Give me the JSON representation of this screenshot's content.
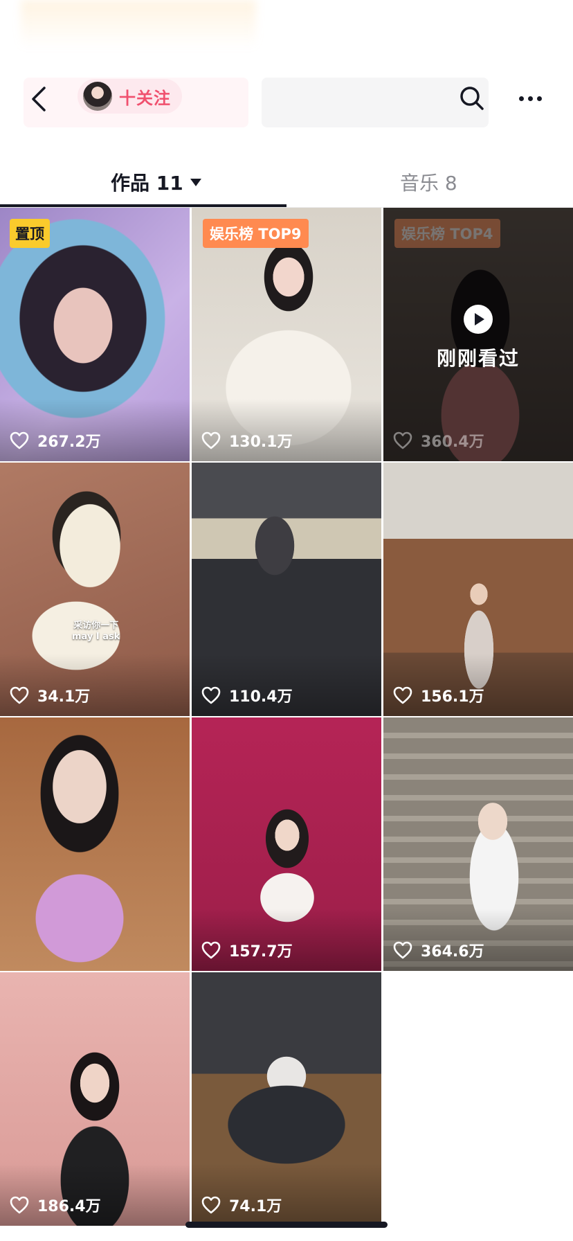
{
  "header": {
    "follow_label": "十关注",
    "back_icon": "chevron-left-icon",
    "search_icon": "search-icon",
    "more_icon": "more-dots-icon"
  },
  "tabs": {
    "works_label": "作品 11",
    "music_label": "音乐 8"
  },
  "videos": [
    {
      "likes": "267.2万",
      "badge": "置顶"
    },
    {
      "likes": "130.1万",
      "badge": "娱乐榜 TOP9"
    },
    {
      "likes": "360.4万",
      "badge": "娱乐榜 TOP4",
      "recent_label": "刚刚看过"
    },
    {
      "likes": "34.1万",
      "sticker_line1": "采访你一下",
      "sticker_line2": "may I ask"
    },
    {
      "likes": "110.4万"
    },
    {
      "likes": "156.1万"
    },
    {
      "likes": "157.7万"
    },
    {
      "likes": "364.6万"
    },
    {
      "likes": "186.4万"
    },
    {
      "likes": "74.1万"
    }
  ],
  "colors": {
    "pin_badge": "#facb2c",
    "rank_badge": "#ff8a50",
    "follow_text": "#f0506e"
  }
}
